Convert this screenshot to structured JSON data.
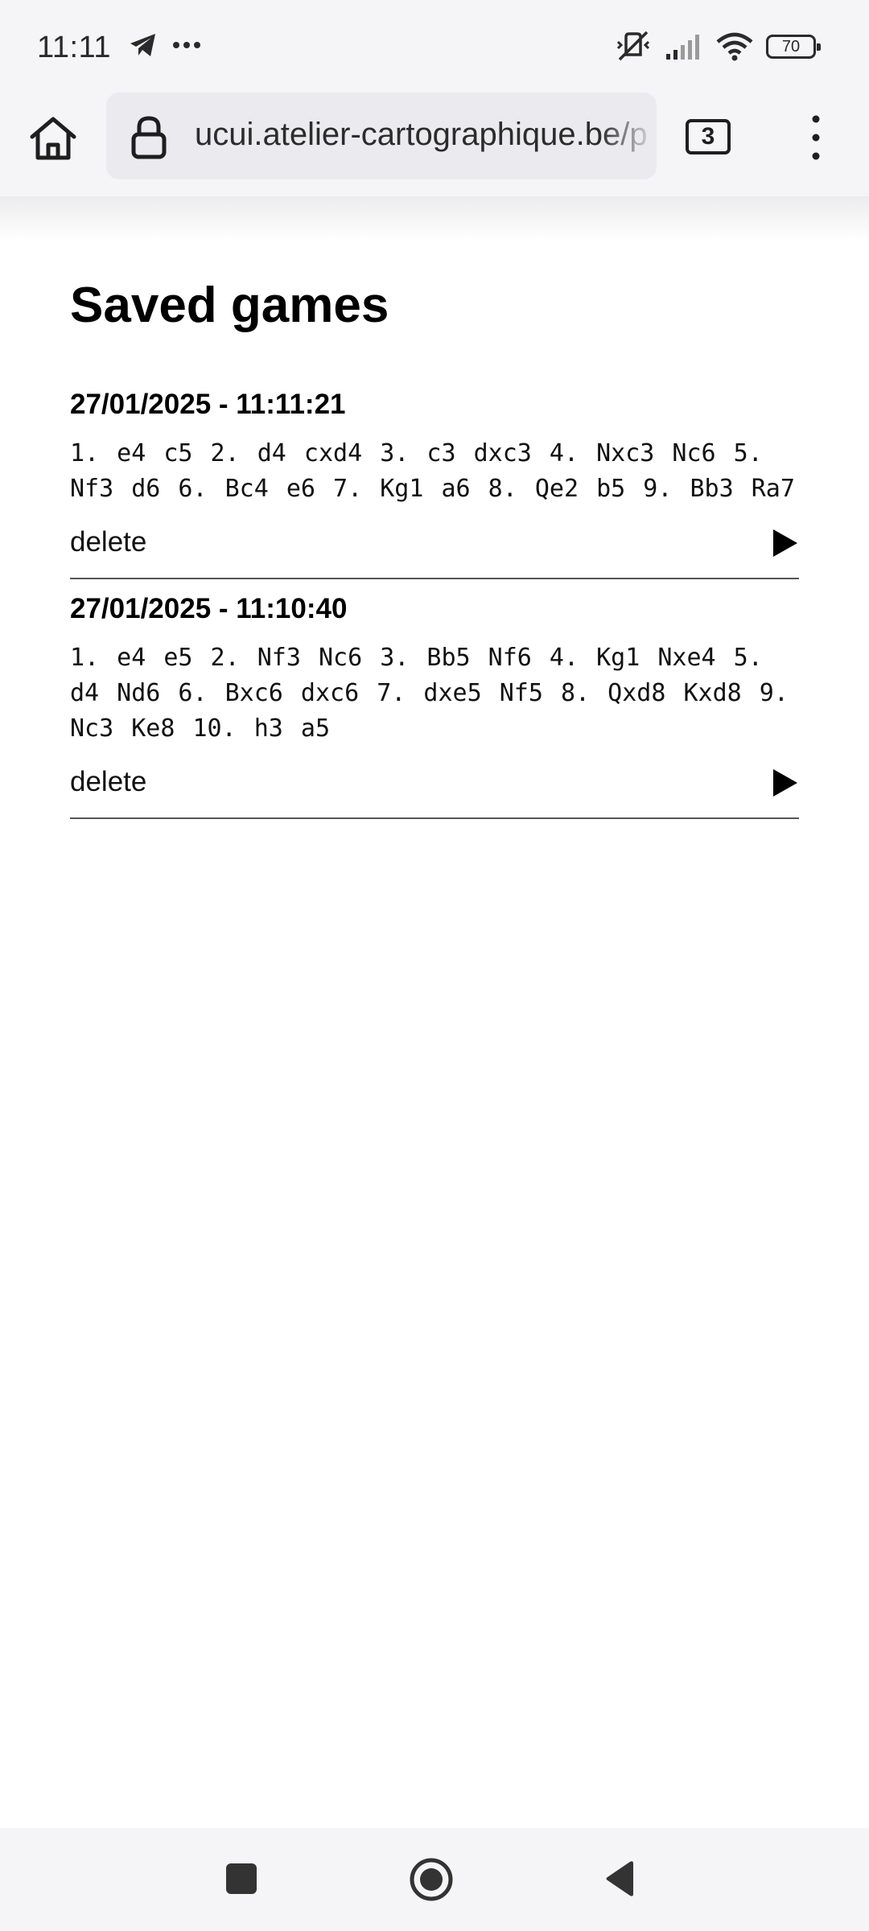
{
  "status_bar": {
    "time": "11:11",
    "left_icons": [
      "telegram-icon",
      "more-notifications-icon"
    ],
    "right_icons": [
      "vibrate-off-icon",
      "signal-icon",
      "wifi-icon"
    ],
    "battery": "70"
  },
  "browser": {
    "url": "ucui.atelier-cartographique.be/p",
    "tab_count": "3",
    "icons": [
      "home-icon",
      "lock-icon",
      "menu-icon"
    ]
  },
  "page": {
    "title": "Saved games",
    "games": [
      {
        "date": "27/01/2025 - 11:11:21",
        "moves": "1. e4 c5 2. d4 cxd4 3. c3 dxc3 4. Nxc3 Nc6 5. Nf3 d6 6. Bc4 e6 7. Kg1 a6 8. Qe2 b5 9. Bb3 Ra7",
        "delete_label": "delete"
      },
      {
        "date": "27/01/2025 - 11:10:40",
        "moves": "1. e4 e5 2. Nf3 Nc6 3. Bb5 Nf6 4. Kg1 Nxe4 5. d4 Nd6 6. Bxc6 dxc6 7. dxe5 Nf5 8. Qxd8 Kxd8 9. Nc3 Ke8 10. h3 a5",
        "delete_label": "delete"
      }
    ]
  },
  "nav_bar": {
    "buttons": [
      "recents-button",
      "home-button",
      "back-button"
    ]
  }
}
